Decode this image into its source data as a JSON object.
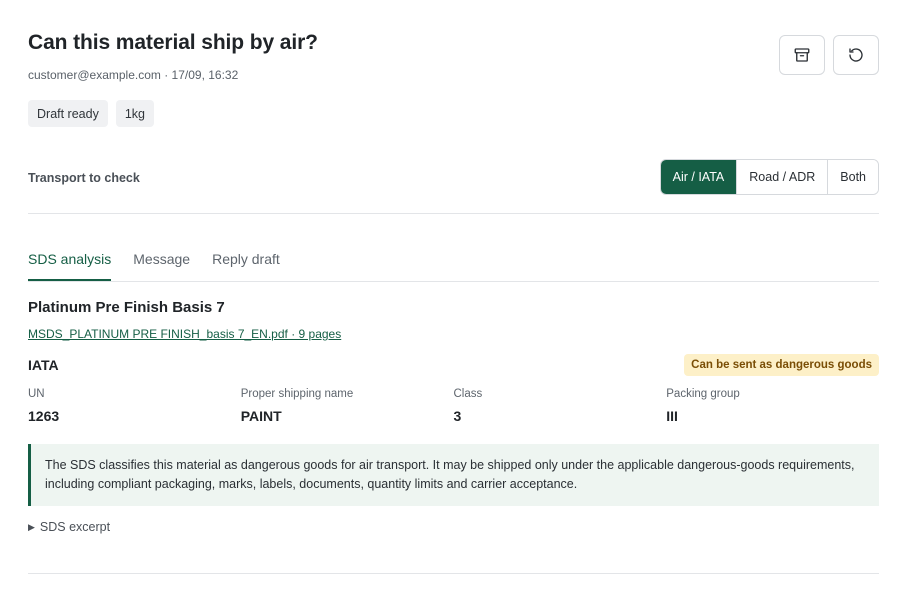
{
  "header": {
    "title": "Can this material ship by air?",
    "meta": "customer@example.com · 17/09, 16:32",
    "actions": [
      {
        "icon": "archive-icon"
      },
      {
        "icon": "refresh-icon"
      }
    ]
  },
  "badges": [
    "Draft ready",
    "1kg"
  ],
  "transport": {
    "label": "Transport to check",
    "options": [
      "Air / IATA",
      "Road / ADR",
      "Both"
    ],
    "selected": "Air / IATA"
  },
  "tabs": {
    "items": [
      "SDS analysis",
      "Message",
      "Reply draft"
    ],
    "active": "SDS analysis"
  },
  "analysis": {
    "product_title": "Platinum Pre Finish Basis 7",
    "file_link": "MSDS_PLATINUM PRE FINISH_basis 7_EN.pdf · 9 pages",
    "section_title": "IATA",
    "status": "Can be sent as dangerous goods",
    "fields": [
      {
        "label": "UN",
        "value": "1263"
      },
      {
        "label": "Proper shipping name",
        "value": "PAINT"
      },
      {
        "label": "Class",
        "value": "3"
      },
      {
        "label": "Packing group",
        "value": "III"
      }
    ],
    "note": "The SDS classifies this material as dangerous goods for air transport. It may be shipped only under the applicable dangerous-goods requirements, including compliant packaging, marks, labels, documents, quantity limits and carrier acceptance.",
    "excerpt_label": "SDS excerpt"
  },
  "colors": {
    "accent": "#155e45",
    "warning_bg": "#fdf0c8",
    "warning_text": "#7a4e06",
    "note_bg": "#eef5f1"
  }
}
